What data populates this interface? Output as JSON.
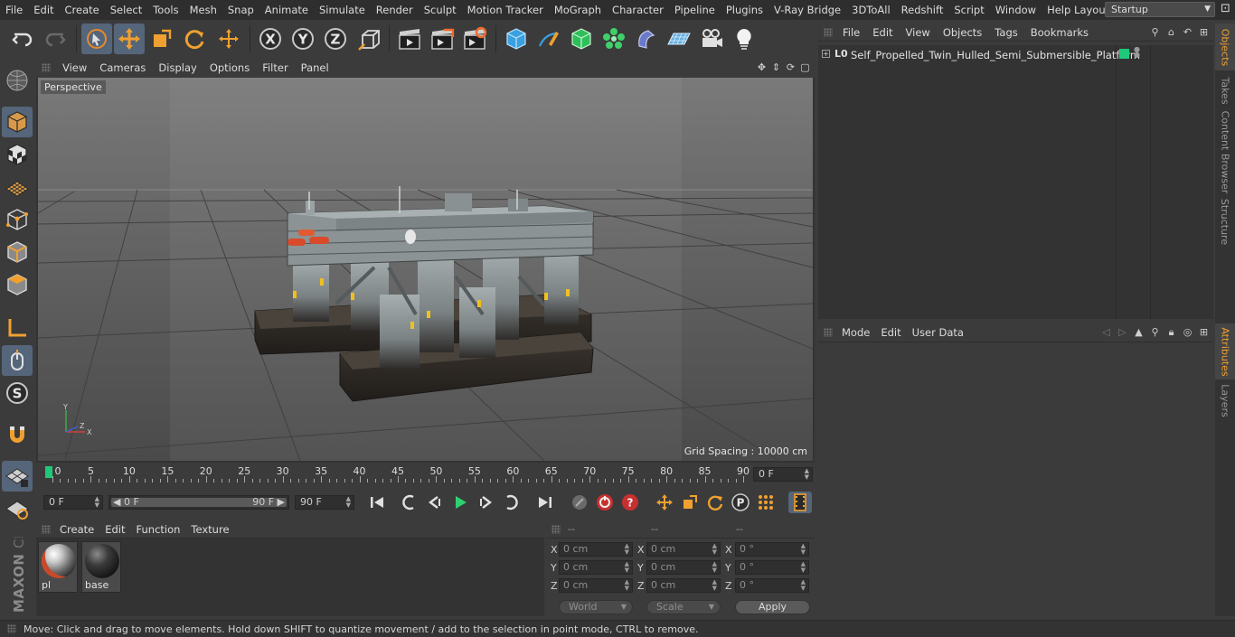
{
  "menubar": {
    "items": [
      "File",
      "Edit",
      "Create",
      "Select",
      "Tools",
      "Mesh",
      "Snap",
      "Animate",
      "Simulate",
      "Render",
      "Sculpt",
      "Motion Tracker",
      "MoGraph",
      "Character",
      "Pipeline",
      "Plugins",
      "V-Ray Bridge",
      "3DToAll",
      "Redshift",
      "Script",
      "Window",
      "Help"
    ],
    "layout_label": "Layout:",
    "layout_value": "Startup"
  },
  "viewport": {
    "menu": [
      "View",
      "Cameras",
      "Display",
      "Options",
      "Filter",
      "Panel"
    ],
    "camera_label": "Perspective",
    "grid_spacing": "Grid Spacing : 10000 cm"
  },
  "timeline": {
    "labels": [
      "0",
      "5",
      "10",
      "15",
      "20",
      "25",
      "30",
      "35",
      "40",
      "45",
      "50",
      "55",
      "60",
      "65",
      "70",
      "75",
      "80",
      "85",
      "90"
    ],
    "current_frame": "0 F"
  },
  "transport": {
    "start_field": "0 F",
    "range_start": "0 F",
    "range_end": "90 F",
    "end_field": "90 F"
  },
  "materials": {
    "menu": [
      "Create",
      "Edit",
      "Function",
      "Texture"
    ],
    "items": [
      {
        "name": "pl"
      },
      {
        "name": "base"
      }
    ]
  },
  "coords": {
    "headers": [
      "--",
      "--",
      "--"
    ],
    "axes": [
      "X",
      "Y",
      "Z"
    ],
    "position": [
      "0 cm",
      "0 cm",
      "0 cm"
    ],
    "size": [
      "0 cm",
      "0 cm",
      "0 cm"
    ],
    "rotation": [
      "0 °",
      "0 °",
      "0 °"
    ],
    "space_dropdown": "World",
    "mode_dropdown": "Scale",
    "apply_label": "Apply"
  },
  "status": {
    "message": "Move: Click and drag to move elements. Hold down SHIFT to quantize movement / add to the selection in point mode, CTRL to remove."
  },
  "object_manager": {
    "menu": [
      "File",
      "Edit",
      "View",
      "Objects",
      "Tags",
      "Bookmarks"
    ],
    "objects": [
      {
        "name": "Self_Propelled_Twin_Hulled_Semi_Submersible_Platform",
        "icon": "null-icon",
        "visible_color": "#1fc97a"
      }
    ]
  },
  "attributes_manager": {
    "menu": [
      "Mode",
      "Edit",
      "User Data"
    ]
  },
  "right_tabs": [
    "Objects",
    "Takes",
    "Content Browser",
    "Structure",
    "Attributes",
    "Layers"
  ],
  "logo": {
    "brand": "MAXON",
    "product": "CINEMA 4D"
  },
  "colors": {
    "accent": "#f0a030",
    "active_button": "#55657a",
    "keyframe_green": "#1fc97a"
  }
}
